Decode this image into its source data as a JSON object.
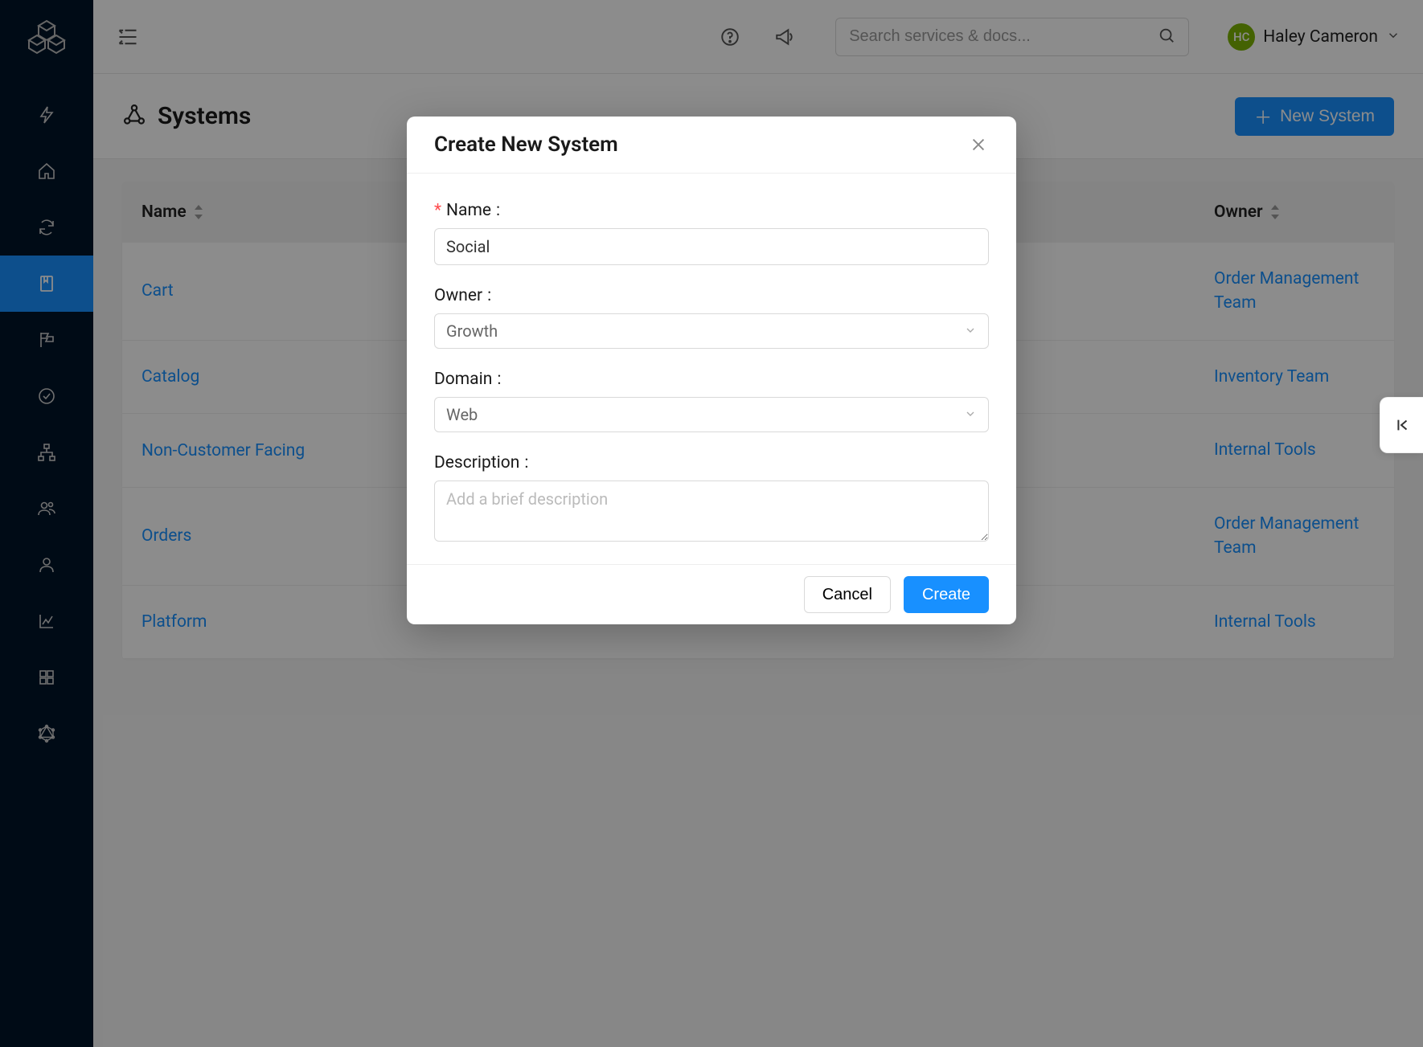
{
  "sidebar": {
    "logo_name": "cubes-logo",
    "items": [
      {
        "name": "bolt-icon"
      },
      {
        "name": "home-icon"
      },
      {
        "name": "refresh-icon"
      },
      {
        "name": "bookmark-icon",
        "active": true
      },
      {
        "name": "flag-icon"
      },
      {
        "name": "check-circle-icon"
      },
      {
        "name": "network-icon"
      },
      {
        "name": "users-icon"
      },
      {
        "name": "user-icon"
      },
      {
        "name": "analytics-icon"
      },
      {
        "name": "apps-grid-icon"
      },
      {
        "name": "graphql-icon"
      }
    ]
  },
  "header": {
    "search_placeholder": "Search services & docs...",
    "user_initials": "HC",
    "user_name": "Haley Cameron"
  },
  "page": {
    "title": "Systems",
    "new_button": "New System"
  },
  "table": {
    "columns": {
      "name": "Name",
      "owner": "Owner"
    },
    "rows": [
      {
        "name": "Cart",
        "owner": "Order Management Team"
      },
      {
        "name": "Catalog",
        "owner": "Inventory Team"
      },
      {
        "name": "Non-Customer Facing",
        "owner": "Internal Tools"
      },
      {
        "name": "Orders",
        "owner": "Order Management Team"
      },
      {
        "name": "Platform",
        "owner": "Internal Tools"
      }
    ]
  },
  "modal": {
    "title": "Create New System",
    "fields": {
      "name_label": "Name",
      "name_value": "Social",
      "owner_label": "Owner",
      "owner_value": "Growth",
      "domain_label": "Domain",
      "domain_value": "Web",
      "description_label": "Description",
      "description_placeholder": "Add a brief description"
    },
    "buttons": {
      "cancel": "Cancel",
      "create": "Create"
    }
  }
}
